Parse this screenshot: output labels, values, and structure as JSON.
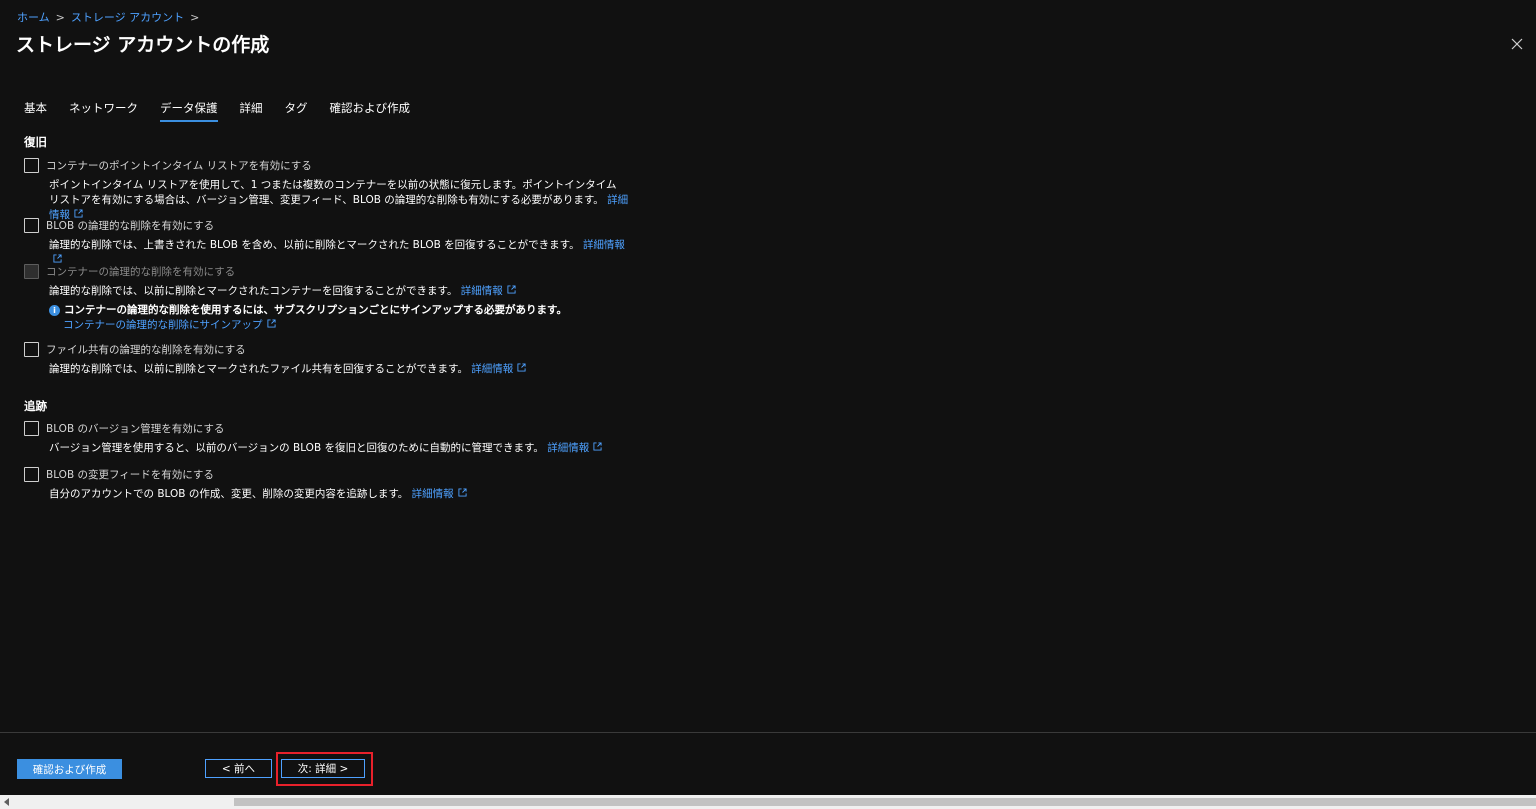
{
  "breadcrumb": {
    "home": "ホーム",
    "storage": "ストレージ アカウント",
    "sep": ">"
  },
  "page": {
    "title": "ストレージ アカウントの作成"
  },
  "tabs": [
    {
      "label": "基本"
    },
    {
      "label": "ネットワーク"
    },
    {
      "label": "データ保護"
    },
    {
      "label": "詳細"
    },
    {
      "label": "タグ"
    },
    {
      "label": "確認および作成"
    }
  ],
  "sections": {
    "recovery": "復旧",
    "tracking": "追跡"
  },
  "options": {
    "pitr": {
      "label": "コンテナーのポイントインタイム リストアを有効にする",
      "desc": "ポイントインタイム リストアを使用して、1 つまたは複数のコンテナーを以前の状態に復元します。ポイントインタイム リストアを有効にする場合は、バージョン管理、変更フィード、BLOB の論理的な削除も有効にする必要があります。",
      "link": "詳細情報"
    },
    "blob_soft_delete": {
      "label": "BLOB の論理的な削除を有効にする",
      "desc": "論理的な削除では、上書きされた BLOB を含め、以前に削除とマークされた BLOB を回復することができます。",
      "link": "詳細情報"
    },
    "container_soft_delete": {
      "label": "コンテナーの論理的な削除を有効にする",
      "desc": "論理的な削除では、以前に削除とマークされたコンテナーを回復することができます。",
      "link": "詳細情報",
      "info_text": "コンテナーの論理的な削除を使用するには、サブスクリプションごとにサインアップする必要があります。",
      "info_link": "コンテナーの論理的な削除にサインアップ"
    },
    "file_share_soft_delete": {
      "label": "ファイル共有の論理的な削除を有効にする",
      "desc": "論理的な削除では、以前に削除とマークされたファイル共有を回復することができます。",
      "link": "詳細情報"
    },
    "versioning": {
      "label": "BLOB のバージョン管理を有効にする",
      "desc": "バージョン管理を使用すると、以前のバージョンの BLOB を復旧と回復のために自動的に管理できます。",
      "link": "詳細情報"
    },
    "change_feed": {
      "label": "BLOB の変更フィードを有効にする",
      "desc": "自分のアカウントでの BLOB の作成、変更、削除の変更内容を追跡します。",
      "link": "詳細情報"
    }
  },
  "footer": {
    "review_create": "確認および作成",
    "prev": "< 前へ",
    "next": "次: 詳細 >"
  },
  "colors": {
    "background": "#111111",
    "accent": "#3b8fe0",
    "link": "#4ea1ff",
    "highlight": "#e8212b"
  }
}
